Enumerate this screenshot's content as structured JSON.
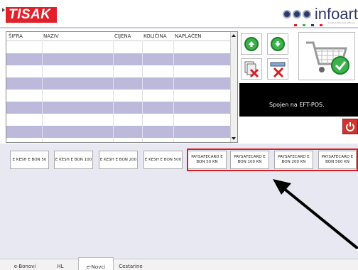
{
  "header": {
    "logo_text": "TISAK",
    "brand_text": "infoart",
    "brand_sub": "izrada poslovnog softvera",
    "brand_colors": [
      "#e2202a",
      "#3bb34a",
      "#2b3a6e",
      "#e2202a"
    ]
  },
  "grid": {
    "columns": [
      "ŠIFRA",
      "NAZIV",
      "CIJENA",
      "KOLIČINA",
      "NAPLAĆEN"
    ],
    "row_colors": {
      "alt": "#bcbadb",
      "normal": "#ffffff"
    }
  },
  "icons": {
    "up": "arrow-up-icon",
    "down": "arrow-down-icon",
    "delete_doc": "delete-document-icon",
    "delete_row": "delete-row-icon",
    "cart": "shopping-cart-check-icon",
    "power": "power-icon"
  },
  "status": {
    "text": "Spojen na EFT-POS."
  },
  "voucher_buttons": [
    "E KESH E BON 50",
    "E KESH E BON 100",
    "E KESH E BON 200",
    "E KESH E BON 500",
    "PAYSAFECARD E BON 50 KN",
    "PAYSAFECARD E BON   100 KN",
    "PAYSAFECARD E BON 200 KN",
    "PAYSAFECARD E BON 500 KN"
  ],
  "tabs": [
    "e-Bonovi",
    "HL",
    "e-Novci",
    "Cestarine"
  ],
  "active_tab": "e-Novci",
  "annotation_color": "#000000",
  "highlight_color": "#d81f26"
}
